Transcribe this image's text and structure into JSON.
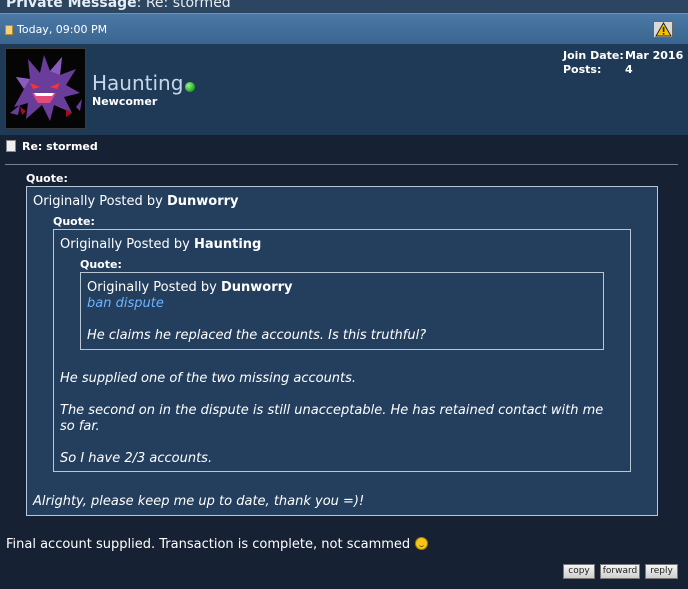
{
  "header": {
    "title": "Private Message",
    "subject_prefix": ": Re: stormed",
    "date": "Today, 09:00 PM"
  },
  "user": {
    "name": "Haunting",
    "rank": "Newcomer",
    "status_color": "#22aa22",
    "join_date_label": "Join Date:",
    "join_date": "Mar 2016",
    "posts_label": "Posts:",
    "posts": "4"
  },
  "message": {
    "title": "Re: stormed",
    "quote_label": "Quote:",
    "outer_quote": {
      "prefix": "Originally Posted by ",
      "author": "Dunworry",
      "text": "Alrighty, please keep me up to date, thank you =)!"
    },
    "middle_quote": {
      "prefix": "Originally Posted by ",
      "author": "Haunting",
      "lines": [
        "He supplied one of the two missing accounts.",
        "The second on in the dispute is still unacceptable. He has retained contact with me",
        "so far.",
        "So I have 2/3 accounts."
      ]
    },
    "inner_quote": {
      "prefix": "Originally Posted by ",
      "author": "Dunworry",
      "link": "ban dispute",
      "text": "He claims he replaced the accounts. Is this truthful?"
    },
    "body": "Final account supplied. Transaction is complete, not scammed"
  },
  "buttons": {
    "copy": "copy",
    "forward": "forward",
    "reply": "reply"
  },
  "icons": {
    "report": "warning-icon",
    "message": "document-icon",
    "smiley": "smiley-icon",
    "online": "online-status-icon"
  }
}
